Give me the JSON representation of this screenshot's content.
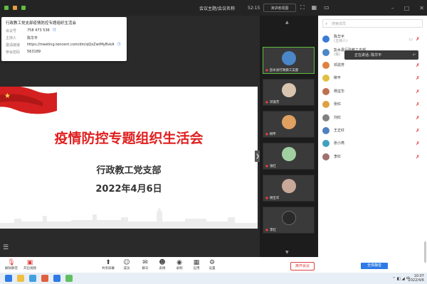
{
  "topbar": {
    "title": "会议主题/会议名称",
    "time": "52:15",
    "layout_label": "演讲者视图"
  },
  "infobox": {
    "header": "行政教工党支部疫情防控专题组织生活会",
    "rows": [
      {
        "key": "会议号",
        "value": "758 473 536"
      },
      {
        "key": "主持人",
        "value": "陈华平"
      },
      {
        "key": "邀请链接",
        "value": "https://meeting.tencent.com/dm/qQxZwtMyBvkA"
      },
      {
        "key": "参会密码",
        "value": "563189"
      }
    ]
  },
  "slide": {
    "main_title": "疫情防控专题组织生活会",
    "subtitle": "行政教工党支部",
    "date": "2022年4月6日",
    "brand_red": "#e02020"
  },
  "gallery": {
    "tiles": [
      {
        "name": "彭水县行政教工支部",
        "face_color": "#4a86c8",
        "active": true
      },
      {
        "name": "邓渝芳",
        "face_color": "#d9c4b0",
        "active": false
      },
      {
        "name": "柳平",
        "face_color": "#e0a060",
        "active": false
      },
      {
        "name": "张红",
        "face_color": "#a0d0a0",
        "active": false
      },
      {
        "name": "杨宝华",
        "face_color": "#c8a898",
        "active": false
      },
      {
        "name": "李红",
        "face_color": "#2a2a2a",
        "active": false
      }
    ]
  },
  "panel": {
    "search_placeholder": "搜索成员",
    "popup_text": "正在讲话: 陈华平",
    "mute_all_label": "全体静音",
    "participants": [
      {
        "name": "陈华平",
        "role": "(主持人)",
        "color": "#3a7bd5"
      },
      {
        "name": "彭水县行政教工支部",
        "role": "(我)",
        "color": "#4a86c8"
      },
      {
        "name": "邓渝芳",
        "role": "",
        "color": "#e08040"
      },
      {
        "name": "柳平",
        "role": "",
        "color": "#e0c040"
      },
      {
        "name": "杨宝华",
        "role": "",
        "color": "#c07050"
      },
      {
        "name": "张红",
        "role": "",
        "color": "#e0a040"
      },
      {
        "name": "刘红",
        "role": "",
        "color": "#808080"
      },
      {
        "name": "王正红",
        "role": "",
        "color": "#5080c0"
      },
      {
        "name": "张小燕",
        "role": "",
        "color": "#40a0c0"
      },
      {
        "name": "李红",
        "role": "",
        "color": "#a07070"
      }
    ]
  },
  "toolbar": {
    "buttons": [
      {
        "label": "解除静音",
        "icon": "mic-icon"
      },
      {
        "label": "开启视频",
        "icon": "video-icon"
      },
      {
        "label": "共享屏幕",
        "icon": "share-screen-icon"
      },
      {
        "label": "成员",
        "icon": "participants-icon"
      },
      {
        "label": "聊天",
        "icon": "chat-icon"
      },
      {
        "label": "表情",
        "icon": "reaction-icon"
      },
      {
        "label": "录制",
        "icon": "record-icon"
      },
      {
        "label": "应用",
        "icon": "apps-icon"
      },
      {
        "label": "设置",
        "icon": "settings-icon"
      }
    ],
    "leave_label": "离开会议"
  },
  "taskbar": {
    "date_line1": "10:07",
    "date_line2": "2022/4/6"
  }
}
